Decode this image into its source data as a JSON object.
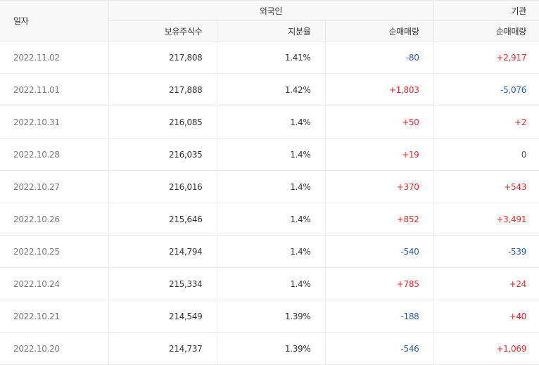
{
  "header": {
    "date_label": "일자",
    "foreign_group": "외국인",
    "institution_group": "기관",
    "columns": {
      "holdings": "보유주식수",
      "ratio": "지분율",
      "foreign_net": "순매매량",
      "institution_net": "순매매량"
    }
  },
  "colors": {
    "up": "#e52b2b",
    "down": "#2a5db0"
  },
  "rows": [
    {
      "date": "2022.11.02",
      "holdings": "217,808",
      "ratio": "1.41%",
      "foreign_net": "-80",
      "institution_net": "+2,917"
    },
    {
      "date": "2022.11.01",
      "holdings": "217,888",
      "ratio": "1.42%",
      "foreign_net": "+1,803",
      "institution_net": "-5,076"
    },
    {
      "date": "2022.10.31",
      "holdings": "216,085",
      "ratio": "1.4%",
      "foreign_net": "+50",
      "institution_net": "+2"
    },
    {
      "date": "2022.10.28",
      "holdings": "216,035",
      "ratio": "1.4%",
      "foreign_net": "+19",
      "institution_net": "0"
    },
    {
      "date": "2022.10.27",
      "holdings": "216,016",
      "ratio": "1.4%",
      "foreign_net": "+370",
      "institution_net": "+543"
    },
    {
      "date": "2022.10.26",
      "holdings": "215,646",
      "ratio": "1.4%",
      "foreign_net": "+852",
      "institution_net": "+3,491"
    },
    {
      "date": "2022.10.25",
      "holdings": "214,794",
      "ratio": "1.4%",
      "foreign_net": "-540",
      "institution_net": "-539"
    },
    {
      "date": "2022.10.24",
      "holdings": "215,334",
      "ratio": "1.4%",
      "foreign_net": "+785",
      "institution_net": "+24"
    },
    {
      "date": "2022.10.21",
      "holdings": "214,549",
      "ratio": "1.39%",
      "foreign_net": "-188",
      "institution_net": "+40"
    },
    {
      "date": "2022.10.20",
      "holdings": "214,737",
      "ratio": "1.39%",
      "foreign_net": "-546",
      "institution_net": "+1,069"
    }
  ]
}
